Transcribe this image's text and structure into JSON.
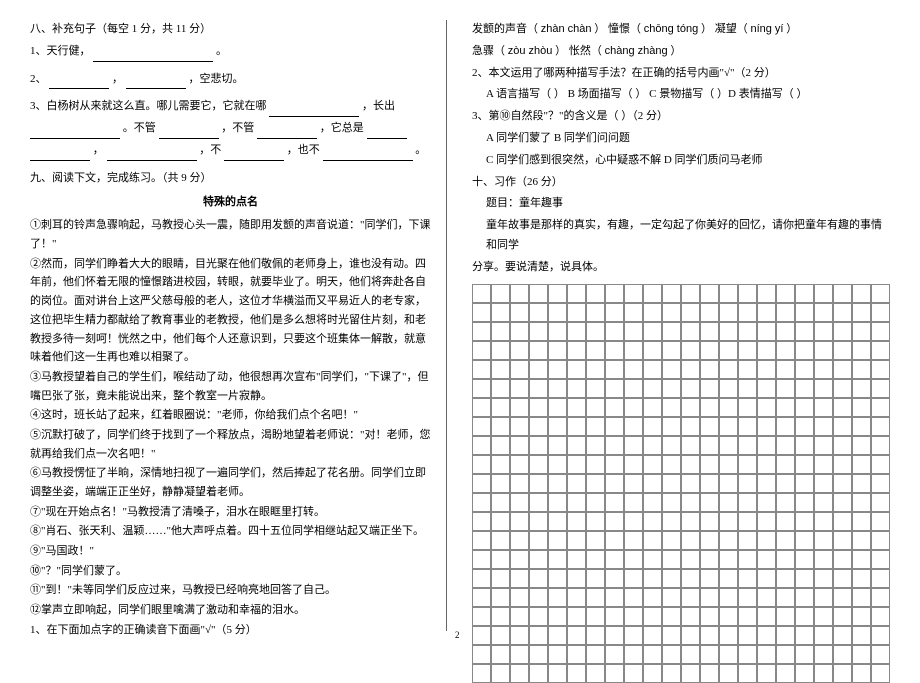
{
  "left": {
    "s8_title": "八、补充句子（每空 1 分，共 11 分）",
    "s8_q1": "1、天行健，",
    "s8_q1_end": "。",
    "s8_q2a": "2、",
    "s8_q2b": "，",
    "s8_q2c": "，空悲切。",
    "s8_q3a": "3、白杨树从来就这么直。哪儿需要它，它就在哪",
    "s8_q3b": "，长出",
    "s8_q3c": "。不管",
    "s8_q3d": "，不管",
    "s8_q3e": "，它总是",
    "s8_q3f": "，",
    "s8_q3g": "，不",
    "s8_q3h": "，也不",
    "s8_q3i": "。",
    "s9_title": "九、阅读下文，完成练习。（共 9 分）",
    "passage_title": "特殊的点名",
    "p1": "①刺耳的铃声急骤响起，马教授心头一震，随即用发颤的声音说道：\"同学们，下课了！\"",
    "p2": "②然而，同学们睁着大大的眼睛，目光聚在他们敬佩的老师身上，谁也没有动。四年前，他们怀着无限的憧憬踏进校园，转眼，就要毕业了。明天，他们将奔赴各自的岗位。面对讲台上这严父慈母般的老人，这位才华横溢而又平易近人的老专家，这位把毕生精力都献给了教育事业的老教授，他们是多么想将时光留住片刻，和老教授多待一刻呵！恍然之中，他们每个人还意识到，只要这个班集体一解散，就意味着他们这一生再也难以相聚了。",
    "p3": "③马教授望着自己的学生们，喉结动了动，他很想再次宣布\"同学们，\"下课了\"，但嘴巴张了张，竟未能说出来，整个教室一片寂静。",
    "p4": "④这时，班长站了起来，红着眼圈说：\"老师，你给我们点个名吧！\"",
    "p5": "⑤沉默打破了，同学们终于找到了一个释放点，渴盼地望着老师说：\"对！老师，您就再给我们点一次名吧！\"",
    "p6": "⑥马教授愣怔了半晌，深情地扫视了一遍同学们，然后捧起了花名册。同学们立即调整坐姿，端端正正坐好，静静凝望着老师。",
    "p7": "⑦\"现在开始点名！\"马教授清了清嗓子，泪水在眼眶里打转。",
    "p8": "⑧\"肖石、张天利、温颖……\"他大声呼点着。四十五位同学相继站起又端正坐下。",
    "p9": "⑨\"马国政！\"",
    "p10": "⑩\"？\"同学们蒙了。",
    "p11": "⑪\"到！\"未等同学们反应过来，马教授已经响亮地回答了自己。",
    "p12": "⑫掌声立即响起，同学们眼里噙满了激动和幸福的泪水。",
    "q1": "1、在下面加点字的正确读音下面画\"√\"（5 分）"
  },
  "right": {
    "pinyin_line1a": "发颤的声音（",
    "pinyin_line1b": "zhàn  chàn",
    "pinyin_line1c": "）  憧憬（",
    "pinyin_line1d": "chōng  tóng",
    "pinyin_line1e": "）  凝望（",
    "pinyin_line1f": "níng  yí",
    "pinyin_line1g": "）",
    "pinyin_line2a": "急骤（",
    "pinyin_line2b": "zòu  zhòu",
    "pinyin_line2c": "）   怅然（",
    "pinyin_line2d": "chàng  zhàng",
    "pinyin_line2e": "）",
    "q2": "2、本文运用了哪两种描写手法？在正确的括号内画\"√\"（2 分）",
    "q2_opts": "A 语言描写（   ）  B 场面描写（   ）  C 景物描写（   ）D 表情描写（   ）",
    "q3": "3、第⑩自然段\"？\"的含义是（    ）（2 分）",
    "q3_opt_ab": "A 同学们蒙了          B 同学们问问题",
    "q3_opt_cd": "C 同学们感到很突然，心中疑惑不解    D 同学们质问马老师",
    "s10_title": "十、习作（26 分）",
    "essay_topic": "题目：童年趣事",
    "essay_prompt1": "童年故事是那样的真实，有趣，一定勾起了你美好的回忆，请你把童年有趣的事情和同学",
    "essay_prompt2": "分享。要说清楚，说具体。"
  },
  "grid": {
    "rows": 21,
    "cols": 22
  },
  "page": "2"
}
